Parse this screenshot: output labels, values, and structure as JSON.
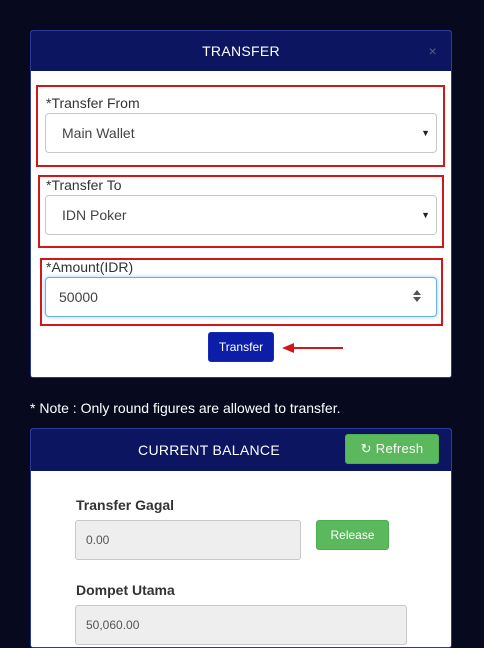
{
  "transfer": {
    "title": "TRANSFER",
    "close_symbol": "×",
    "from_label": "*Transfer From",
    "from_value": "Main Wallet",
    "to_label": "*Transfer To",
    "to_value": "IDN Poker",
    "amount_label": "*Amount(IDR)",
    "amount_value": "50000",
    "button_label": "Transfer",
    "highlight_color": "#d11818"
  },
  "note": "* Note : Only round figures are allowed to transfer.",
  "balance": {
    "title": "CURRENT BALANCE",
    "refresh_label": "Refresh",
    "items": [
      {
        "label": "Transfer Gagal",
        "value": "0.00",
        "action": "Release"
      },
      {
        "label": "Dompet Utama",
        "value": "50,060.00"
      }
    ]
  },
  "colors": {
    "background": "#070a1f",
    "header": "#0b1560",
    "primary_button": "#0c1ea8",
    "success_button": "#5cb85c"
  },
  "icons": {
    "refresh": "refresh-icon",
    "close": "close-icon",
    "dropdown": "chevron-down-icon"
  }
}
